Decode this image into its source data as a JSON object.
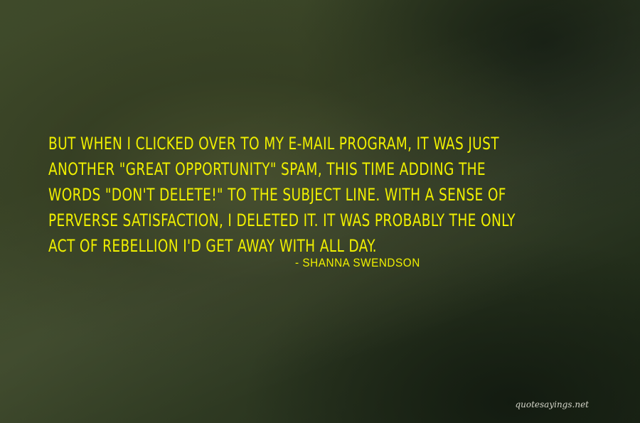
{
  "quote": {
    "lines": [
      "BUT WHEN I CLICKED OVER TO MY E-MAIL PROGRAM, IT WAS JUST",
      "ANOTHER \"GREAT OPPORTUNITY\" SPAM, THIS TIME ADDING THE",
      "WORDS \"DON'T DELETE!\" TO THE SUBJECT LINE. WITH A SENSE OF",
      "PERVERSE SATISFACTION, I DELETED IT. IT WAS PROBABLY THE ONLY",
      "ACT OF REBELLION I'D GET AWAY WITH ALL DAY."
    ],
    "author": "- SHANNA SWENDSON"
  },
  "site": {
    "watermark": "quotesayings.net"
  },
  "colors": {
    "text": "#f0f000",
    "background_light": "#46502c",
    "background_dark": "#1d2817",
    "watermark": "#e8e8dc"
  }
}
